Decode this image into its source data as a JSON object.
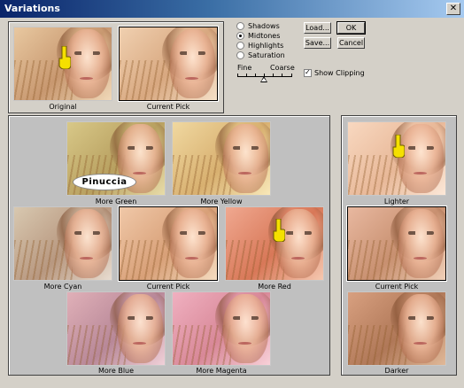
{
  "window": {
    "title": "Variations",
    "close_glyph": "✕"
  },
  "originals": {
    "original_label": "Original",
    "current_pick_label": "Current Pick"
  },
  "tones": {
    "options": [
      "Shadows",
      "Midtones",
      "Highlights",
      "Saturation"
    ],
    "selected": "Midtones"
  },
  "slider": {
    "fine_label": "Fine",
    "coarse_label": "Coarse"
  },
  "buttons": {
    "load": "Load...",
    "ok": "OK",
    "save": "Save...",
    "cancel": "Cancel"
  },
  "show_clipping": {
    "label": "Show Clipping",
    "checked": true
  },
  "variations": {
    "more_green": "More Green",
    "more_yellow": "More Yellow",
    "more_cyan": "More Cyan",
    "current_pick": "Current Pick",
    "more_red": "More Red",
    "more_blue": "More Blue",
    "more_magenta": "More Magenta"
  },
  "brightness": {
    "lighter": "Lighter",
    "current_pick": "Current Pick",
    "darker": "Darker"
  },
  "watermark": "Pinuccia",
  "colors": {
    "title_start": "#0a246a",
    "title_end": "#a6caf0",
    "dialog_bg": "#d4d0c8",
    "panel_bg": "#c0c0c0",
    "pointer_hand": "#f5e000"
  },
  "icons": {
    "pointer": "pointing-hand-icon",
    "close": "close-icon"
  }
}
